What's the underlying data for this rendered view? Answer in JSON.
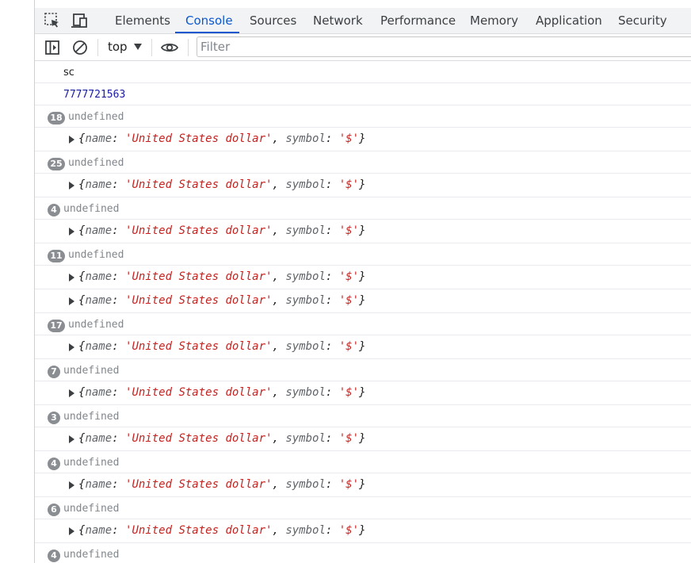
{
  "tabs": {
    "elements": "Elements",
    "console": "Console",
    "sources": "Sources",
    "network": "Network",
    "performance": "Performance",
    "memory": "Memory",
    "application": "Application",
    "security": "Security"
  },
  "toolbar": {
    "context": "top",
    "filter_placeholder": "Filter"
  },
  "object_preview": {
    "open": "{",
    "name_key": "name",
    "name_value": "'United States dollar'",
    "symbol_key": "symbol",
    "symbol_value": "'$'",
    "close": "}",
    "colon": ": ",
    "comma": ", "
  },
  "console_log": [
    {
      "kind": "text",
      "text": "sc"
    },
    {
      "kind": "number",
      "text": "7777721563"
    },
    {
      "kind": "undefined",
      "count": "18",
      "text": "undefined"
    },
    {
      "kind": "object"
    },
    {
      "kind": "undefined",
      "count": "25",
      "text": "undefined"
    },
    {
      "kind": "object"
    },
    {
      "kind": "undefined",
      "count": "4",
      "text": "undefined"
    },
    {
      "kind": "object"
    },
    {
      "kind": "undefined",
      "count": "11",
      "text": "undefined"
    },
    {
      "kind": "object"
    },
    {
      "kind": "object"
    },
    {
      "kind": "undefined",
      "count": "17",
      "text": "undefined"
    },
    {
      "kind": "object"
    },
    {
      "kind": "undefined",
      "count": "7",
      "text": "undefined"
    },
    {
      "kind": "object"
    },
    {
      "kind": "undefined",
      "count": "3",
      "text": "undefined"
    },
    {
      "kind": "object"
    },
    {
      "kind": "undefined",
      "count": "4",
      "text": "undefined"
    },
    {
      "kind": "object"
    },
    {
      "kind": "undefined",
      "count": "6",
      "text": "undefined"
    },
    {
      "kind": "object"
    },
    {
      "kind": "undefined",
      "count": "4",
      "text": "undefined"
    }
  ],
  "colors": {
    "accent": "#0b57d0",
    "string": "#c5221f",
    "number": "#1a1aa6",
    "undefined": "#80868b",
    "badge": "#8a8d91"
  }
}
